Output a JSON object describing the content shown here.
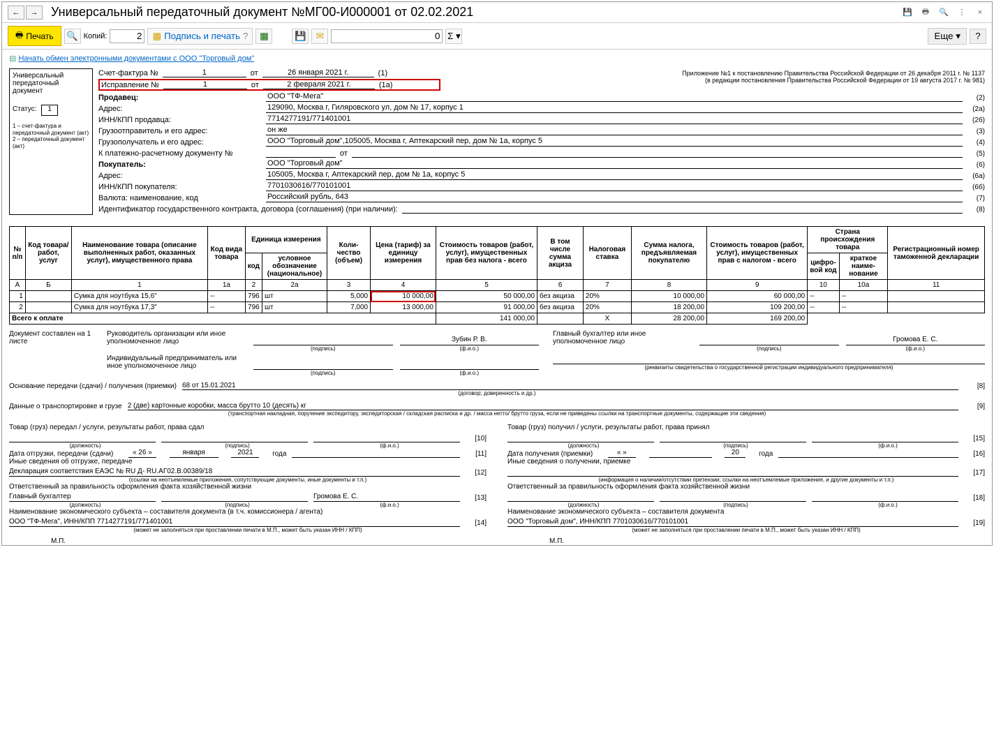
{
  "title": "Универсальный передаточный документ №МГ00-И000001 от 02.02.2021",
  "toolbar": {
    "print": "Печать",
    "copies_label": "Копий:",
    "copies_value": "2",
    "sign_print": "Подпись и печать",
    "num_value": "0",
    "more": "Еще",
    "help": "?"
  },
  "link": "Начать обмен электронными документами с ООО \"Торговый дом\"",
  "left": {
    "title1": "Универсальный",
    "title2": "передаточный",
    "title3": "документ",
    "status_label": "Статус:",
    "status_value": "1",
    "legend": "1 – счет-фактура и передаточный документ (акт)\n2 – передаточный документ (акт)"
  },
  "invoice": {
    "label": "Счет-фактура №",
    "num": "1",
    "ot": "от",
    "date": "26 января 2021 г.",
    "suffix": "(1)"
  },
  "correction": {
    "label": "Исправление №",
    "num": "1",
    "ot": "от",
    "date": "2 февраля 2021 г.",
    "suffix": "(1а)"
  },
  "appendix": {
    "l1": "Приложение №1 к постановлению Правительства Российской Федерации от 26 декабря 2011 г. № 1137",
    "l2": "(в редакции постановления Правительства Российской Федерации от 19 августа 2017 г. № 981)"
  },
  "header": {
    "seller_label": "Продавец:",
    "seller": "ООО \"ТФ-Мега\"",
    "address_label": "Адрес:",
    "address": "129090, Москва г, Гиляровского ул, дом № 17, корпус 1",
    "inn_label": "ИНН/КПП продавца:",
    "inn": "7714277191/771401001",
    "shipper_label": "Грузоотправитель и его адрес:",
    "shipper": "он же",
    "consignee_label": "Грузополучатель и его адрес:",
    "consignee": "ООО \"Торговый дом\",105005, Москва г, Аптекарский пер, дом № 1а, корпус 5",
    "paydoc_label": "К платежно-расчетному документу №",
    "paydoc_ot": "от",
    "buyer_label": "Покупатель:",
    "buyer": "ООО \"Торговый дом\"",
    "baddr_label": "Адрес:",
    "baddr": "105005, Москва г, Аптекарский пер, дом № 1а, корпус 5",
    "binn_label": "ИНН/КПП покупателя:",
    "binn": "7701030616/770101001",
    "currency_label": "Валюта: наименование, код",
    "currency": "Российский рубль, 643",
    "contract_label": "Идентификатор государственного контракта, договора (соглашения) (при наличии):"
  },
  "tbl": {
    "h_num": "№ п/п",
    "h_code": "Код товара/ работ, услуг",
    "h_name": "Наименование товара (описание выполненных работ, оказанных услуг), имущественного права",
    "h_kind": "Код вида товара",
    "h_unit": "Единица измерения",
    "h_unit_code": "код",
    "h_unit_name": "условное обозна­чение (нацио­нальное)",
    "h_qty": "Коли­чество (объем)",
    "h_price": "Цена (тариф) за единицу измерения",
    "h_cost": "Стоимость товаров (работ, услуг), имущест­венных прав без налога - всего",
    "h_excise": "В том числе сумма акциза",
    "h_rate": "Налоговая ставка",
    "h_tax": "Сумма налога, предъяв­ляемая покупателю",
    "h_total": "Стоимость товаров (работ, услуг), имущест­венных прав с налогом - всего",
    "h_country": "Страна происхождения товара",
    "h_ccode": "циф­ро­вой код",
    "h_cname": "краткое наиме­нование",
    "h_reg": "Регистрационный номер таможенной декларации",
    "c_a": "А",
    "c_b": "Б",
    "c_1": "1",
    "c_1a": "1а",
    "c_2": "2",
    "c_2a": "2а",
    "c_3": "3",
    "c_4": "4",
    "c_5": "5",
    "c_6": "6",
    "c_7": "7",
    "c_8": "8",
    "c_9": "9",
    "c_10": "10",
    "c_10a": "10а",
    "c_11": "11",
    "r1": {
      "n": "1",
      "name": "Сумка для ноутбука 15,6\"",
      "kind": "--",
      "ucode": "796",
      "uname": "шт",
      "qty": "5,000",
      "price": "10 000,00",
      "cost": "50 000,00",
      "excise": "без акциза",
      "rate": "20%",
      "tax": "10 000,00",
      "total": "60 000,00",
      "cc": "--",
      "cn": "--"
    },
    "r2": {
      "n": "2",
      "name": "Сумка для ноутбука 17,3\"",
      "kind": "--",
      "ucode": "796",
      "uname": "шт",
      "qty": "7,000",
      "price": "13 000,00",
      "cost": "91 000,00",
      "excise": "без акциза",
      "rate": "20%",
      "tax": "18 200,00",
      "total": "109 200,00",
      "cc": "--",
      "cn": "--"
    },
    "total_label": "Всего к оплате",
    "total_cost": "141 000,00",
    "total_x": "Х",
    "total_tax": "28 200,00",
    "total_sum": "169 200,00"
  },
  "sig": {
    "pages": "Документ составлен на 1 листе",
    "head_label": "Руководитель организации или иное уполномоченное лицо",
    "head_name": "Зубин Р. В.",
    "acc_label": "Главный бухгалтер или иное уполномоченное лицо",
    "acc_name": "Громова Е. С.",
    "ip_label": "Индивидуальный предприниматель или иное уполномоченное лицо",
    "cap_sign": "(подпись)",
    "cap_fio": "(ф.и.о.)",
    "cap_ip": "(реквизиты свидетельства о государственной регистрации индивидуального предпринимателя)"
  },
  "basis": {
    "label": "Основание передачи (сдачи) / получения (приемки)",
    "value": "68 от 15.01.2021",
    "cap": "(договор; доверенность и др.)",
    "num": "[8]"
  },
  "transport": {
    "label": "Данные о транспортировке и грузе",
    "value": "2 (две) картонные коробки, масса брутто 10 (десять) кг",
    "cap": "(транспортная накладная, поручение экспедитору, экспедиторская / складская расписка и др. / масса нетто/ брутто груза, если не приведены ссылки на транспортные документы, содержащие эти сведения)",
    "num": "[9]"
  },
  "left_bot": {
    "pass_label": "Товар (груз) передал / услуги, результаты работ, права сдал",
    "num10": "[10]",
    "cap_pos": "(должность)",
    "cap_sign": "(подпись)",
    "cap_fio": "(ф.и.о.)",
    "date_label": "Дата отгрузки, передачи (сдачи)",
    "date_d": "« 26 »",
    "date_m": "января",
    "date_y": "2021",
    "date_year": "года",
    "num11": "[11]",
    "other_label": "Иные сведения об отгрузке, передаче",
    "decl": "Декларация соответствия ЕАЭС № RU Д- RU.АГ02.В.00389/18",
    "num12": "[12]",
    "decl_cap": "(ссылки на неотъемлемые приложения, сопутствующие документы, иные документы и т.п.)",
    "resp_label": "Ответственный за правильность оформления факта хозяйственной жизни",
    "resp_pos": "Главный бухгалтер",
    "resp_name": "Громова Е. С.",
    "num13": "[13]",
    "econ_label": "Наименование экономического субъекта – составителя документа (в т.ч. комиссионера / агента)",
    "econ_val": "ООО \"ТФ-Мега\", ИНН/КПП 7714277191/771401001",
    "num14": "[14]",
    "econ_cap": "(может не заполняться при проставлении печати в М.П., может быть указан ИНН / КПП)",
    "mp": "М.П."
  },
  "right_bot": {
    "recv_label": "Товар (груз) получил / услуги, результаты работ, права принял",
    "num15": "[15]",
    "date_label": "Дата получения (приемки)",
    "date_d": "«       »",
    "date_y": "20",
    "date_year": "года",
    "num16": "[16]",
    "other_label": "Иные сведения о получении, приемке",
    "num17": "[17]",
    "other_cap": "(информация о наличии/отсутствии претензии; ссылки на неотъемлемые приложения, и другие документы и т.п.)",
    "resp_label": "Ответственный за правильность оформления факта хозяйственной жизни",
    "num18": "[18]",
    "econ_label": "Наименование экономического субъекта – составителя документа",
    "econ_val": "ООО \"Торговый дом\", ИНН/КПП 7701030616/770101001",
    "num19": "[19]",
    "econ_cap": "(может не заполняться при проставлении печати в М.П., может быть указан ИНН / КПП)",
    "mp": "М.П."
  }
}
